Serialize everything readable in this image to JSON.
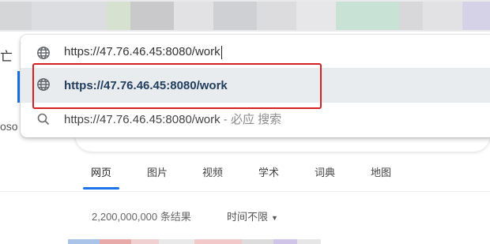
{
  "omnibox": {
    "input_value": "https://47.76.46.45:8080/work",
    "suggestions": [
      {
        "icon": "globe-icon",
        "label": "https://47.76.46.45:8080/work"
      },
      {
        "icon": "search-icon",
        "label": "https://47.76.46.45:8080/work",
        "suffix": " - 必应 搜索"
      }
    ]
  },
  "left_partial": {
    "top_text": "亡",
    "bottom_text": "oso"
  },
  "nav": {
    "tabs": [
      "网页",
      "图片",
      "视频",
      "学术",
      "词典",
      "地图"
    ],
    "active_index": 0
  },
  "results": {
    "count_text": "2,200,000,000 条结果",
    "time_filter": "时间不限"
  },
  "colors": {
    "accent": "#1a73e8",
    "highlight_box": "#d42020",
    "selected_row_bg": "#e9ecef"
  }
}
